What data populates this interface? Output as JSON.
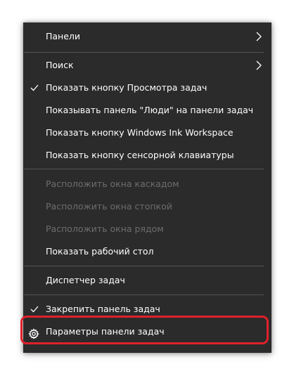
{
  "menu": {
    "panels_label": "Панели",
    "search_label": "Поиск",
    "show_task_view_label": "Показать кнопку Просмотра задач",
    "show_people_label": "Показывать панель \"Люди\" на панели задач",
    "show_ink_label": "Показать кнопку Windows Ink Workspace",
    "show_keyboard_label": "Показать кнопку сенсорной клавиатуры",
    "cascade_label": "Расположить окна каскадом",
    "stack_label": "Расположить окна стопкой",
    "side_by_side_label": "Расположить окна рядом",
    "show_desktop_label": "Показать рабочий стол",
    "task_manager_label": "Диспетчер задач",
    "lock_taskbar_label": "Закрепить панель задач",
    "taskbar_settings_label": "Параметры панели задач"
  },
  "icons": {
    "check": "checkmark-icon",
    "submenu": "chevron-right-icon",
    "settings": "gear-icon"
  },
  "colors": {
    "menu_background": "#2b2b2b",
    "text": "#ffffff",
    "disabled_text": "#6d6d6d",
    "separator": "#555555",
    "highlight_outline": "#e0212a"
  }
}
